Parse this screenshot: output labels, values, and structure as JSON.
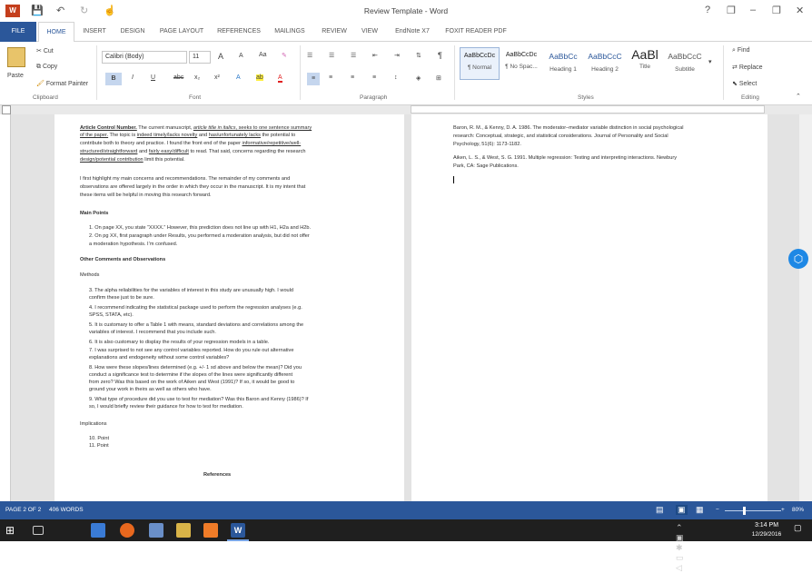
{
  "window": {
    "title": "Review Template - Word",
    "help": "?",
    "minimize": "‒",
    "restore": "❐",
    "close": "✕"
  },
  "quick_access": {
    "save": "💾",
    "undo": "↶",
    "redo": "↻",
    "touch": "☝"
  },
  "tabs": [
    {
      "id": "file",
      "label": "FILE"
    },
    {
      "id": "home",
      "label": "HOME"
    },
    {
      "id": "insert",
      "label": "INSERT"
    },
    {
      "id": "design",
      "label": "DESIGN"
    },
    {
      "id": "layout",
      "label": "PAGE LAYOUT"
    },
    {
      "id": "refs",
      "label": "REFERENCES"
    },
    {
      "id": "mail",
      "label": "MAILINGS"
    },
    {
      "id": "review",
      "label": "REVIEW"
    },
    {
      "id": "view",
      "label": "VIEW"
    },
    {
      "id": "endnote",
      "label": "EndNote X7"
    },
    {
      "id": "foxit",
      "label": "FOXIT READER PDF"
    }
  ],
  "clipboard": {
    "paste": "Paste",
    "cut": "Cut",
    "copy": "Copy",
    "format_painter": "Format Painter",
    "group": "Clipboard"
  },
  "font": {
    "name": "Calibri (Body)",
    "size": "11",
    "group": "Font",
    "grow": "A",
    "shrink": "A",
    "case": "Aa",
    "bold": "B",
    "italic": "I",
    "underline": "U",
    "strike": "abc",
    "sub": "x₂",
    "sup": "x²"
  },
  "paragraph": {
    "group": "Paragraph"
  },
  "styles": {
    "group": "Styles",
    "items": [
      {
        "preview": "AaBbCcDc",
        "name": "¶ Normal"
      },
      {
        "preview": "AaBbCcDc",
        "name": "¶ No Spac..."
      },
      {
        "preview": "AaBbCc",
        "name": "Heading 1"
      },
      {
        "preview": "AaBbCcC",
        "name": "Heading 2"
      },
      {
        "preview": "AaBl",
        "name": "Title"
      },
      {
        "preview": "AaBbCcC",
        "name": "Subtitle"
      }
    ]
  },
  "editing": {
    "group": "Editing",
    "find": "Find",
    "replace": "Replace",
    "select": "Select"
  },
  "left_page": {
    "p1": [
      [
        "Article Control Number.",
        " The current manuscript, ",
        "article title in italics",
        ", seeks to one sentence summary"
      ],
      [
        "of the paper.",
        " The topic is ",
        "indeed timely/lacks novelty",
        " and ",
        "has/unfortunately lacks",
        " the potential to"
      ],
      [
        "contribute both to theory and practice. I found the front end of the paper ",
        "informative/repetitive/well-"
      ],
      [
        "structured/straightforward",
        " and ",
        "fairly easy/difficult",
        " to read. That said, concerns regarding the research"
      ],
      [
        "design/potential contribution",
        " limit this potential."
      ]
    ],
    "p2": [
      "I first highlight my main concerns and recommendations. The remainder of my comments and",
      "observations are offered largely in the order in which they occur in the manuscript. It is my intent that",
      "these items will be helpful in moving this research forward."
    ],
    "main_points_heading": "Main Points",
    "main_points": [
      "1.   On page XX, you state “XXXX.” However, this prediction does not line up with H1, H2a and H2b.",
      "2.   On pg XX, first paragraph under Results, you performed a moderation analysis, but did not offer",
      "       a moderation hypothesis. I’m confused."
    ],
    "other_heading": "Other Comments and Observations",
    "methods_heading": "Methods",
    "methods": [
      "3.    The alpha reliabilities for the variables of interest in this study are unusually high. I would",
      "        confirm these just to be sure.",
      "4.    I recommend indicating the statistical package used to perform the regression analyses (e.g.",
      "        SPSS, STATA, etc).",
      "5.    It is customary to offer a Table 1 with means, standard deviations and correlations among the",
      "        variables of interest. I recommend that you include such.",
      "6.    It is also customary to display the results of your regression models in a table.",
      "7.    I was surprised to not see any control variables reported. How do you rule out alternative",
      "        explanations and endogeneity without some control variables?",
      "8.    How were these slopes/lines determined (e.g. +/- 1 sd above and below the mean)? Did you",
      "        conduct a significance test to determine if the slopes of the lines were significantly different",
      "        from zero? Was this based on the work of Aiken and West (1991)? If so, it would be good to",
      "        ground your work in theirs as well as others who have.",
      "9.    What type of procedure did you use to test for mediation? Was this Baron and Kenny (1986)? If",
      "        so, I would briefly review their guidance for how to test for mediation."
    ],
    "implications_heading": "Implications",
    "implications": [
      "10.  Point",
      "11.  Point"
    ],
    "references_heading": "References"
  },
  "right_page": {
    "lines": [
      "Baron, R. M., & Kenny, D. A. 1986. The moderator–mediator variable distinction in social psychological",
      "research: Conceptual, strategic, and statistical considerations. Journal of Personality and Social",
      "Psychology, 51(6): 1173-1182.",
      "Aiken, L. S., & West, S. G. 1991. Multiple regression: Testing and interpreting interactions. Newbury",
      "Park, CA: Sage Publications."
    ]
  },
  "status": {
    "page": "PAGE 2 OF 2",
    "words": "406 WORDS",
    "zoom": "80%"
  },
  "taskbar": {
    "time": "3:14 PM",
    "date": "12/29/2016"
  },
  "colors": {
    "accent": "#2b579a",
    "file_tab": "#2b579a",
    "taskbar": "#1f1f1f"
  }
}
